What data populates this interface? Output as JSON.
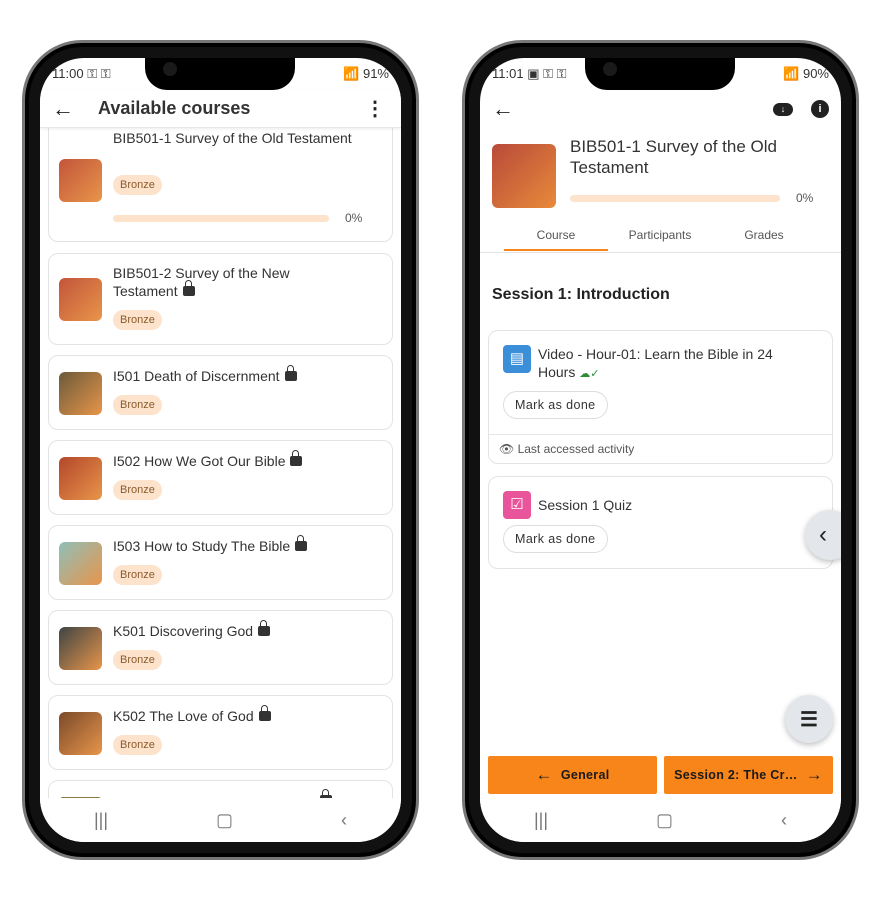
{
  "left": {
    "status": {
      "time": "11:00",
      "icons": "⚿ ⚿",
      "right": "91%"
    },
    "appbar": {
      "title": "Available courses"
    },
    "courses": [
      {
        "title": "BIB501-1 Survey of the Old Testament",
        "badge": "Bronze",
        "locked": false,
        "progress": 0,
        "progress_label": "0%",
        "thumb": "#c2553a"
      },
      {
        "title": "BIB501-2 Survey of the New Testament",
        "badge": "Bronze",
        "locked": true,
        "thumb": "#c2553a"
      },
      {
        "title": "I501 Death of Discernment",
        "badge": "Bronze",
        "locked": true,
        "thumb": "#6b5a3a"
      },
      {
        "title": "I502 How We Got Our Bible",
        "badge": "Bronze",
        "locked": true,
        "thumb": "#b3472a"
      },
      {
        "title": "I503 How to Study The Bible",
        "badge": "Bronze",
        "locked": true,
        "thumb": "#8fbfb8"
      },
      {
        "title": "K501 Discovering God",
        "badge": "Bronze",
        "locked": true,
        "thumb": "#3e4444"
      },
      {
        "title": "K502 The Love of God",
        "badge": "Bronze",
        "locked": true,
        "thumb": "#7a4a2a"
      }
    ]
  },
  "right": {
    "status": {
      "time": "11:01",
      "icons": "▣ ⚿ ⚿",
      "right": "90%"
    },
    "course": {
      "title": "BIB501-1 Survey of the Old Testament",
      "progress": 0,
      "progress_label": "0%"
    },
    "tabs": [
      {
        "label": "Course",
        "active": true
      },
      {
        "label": "Participants"
      },
      {
        "label": "Grades"
      }
    ],
    "section_title": "Session 1: Introduction",
    "activities": [
      {
        "title": "Video - Hour-01: Learn the Bible in 24 Hours",
        "icon": "document-icon",
        "color": "#3b8fd9",
        "button": "Mark as done",
        "footer": "Last accessed activity"
      },
      {
        "title": "Session 1 Quiz",
        "icon": "quiz-icon",
        "color": "#e9559b",
        "button": "Mark as done"
      }
    ],
    "prev_button": "General",
    "next_button": "Session 2: The Cr…"
  },
  "colors": {
    "accent": "#f7851a",
    "badge_bg": "#fde3cc",
    "progress_bg": "#fde3cc"
  }
}
